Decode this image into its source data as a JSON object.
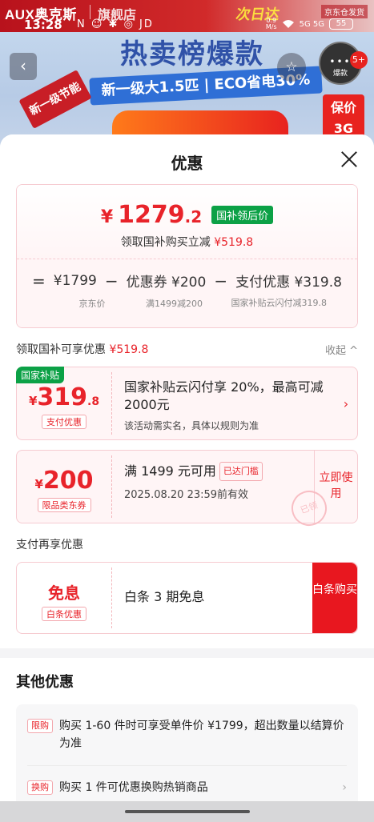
{
  "background": {
    "brand": "AUX奥克斯",
    "shop": "旗舰店",
    "promo": "次日达",
    "badge": "京东仓发货",
    "hero_title": "热卖榜爆款",
    "hero_sub": "新一级大1.5匹 | ECO省电30%",
    "hero_tag": "新一级节能",
    "hero_save": "保价 3G",
    "hot_label": "爆款",
    "hot_dots": "•••",
    "hot_count": "5+",
    "back_icon": "arrow-left-icon"
  },
  "status": {
    "time": "13:28",
    "icons": "N ☺ ✱ ◎ JD",
    "net_speed_value": "0.9",
    "net_speed_unit": "M/s",
    "wifi": "wifi-icon",
    "signal": "5G 5G",
    "battery": "55"
  },
  "sheet": {
    "title": "优惠",
    "close_icon": "close-icon"
  },
  "price": {
    "yen": "¥",
    "integer": "1279",
    "decimal": ".2",
    "badge": "国补领后价",
    "subtitle_prefix": "领取国补购买立减",
    "subtitle_amount": "¥519.8",
    "calc": {
      "equals": "=",
      "base": "¥1799",
      "minus": "−",
      "coupon": "优惠券 ¥200",
      "pay": "支付优惠 ¥319.8",
      "base_label": "京东价",
      "coupon_label": "满1499减200",
      "pay_label": "国家补贴云闪付减319.8"
    }
  },
  "subsidy": {
    "section_title": "领取国补可享优惠",
    "section_amount": "¥519.8",
    "collapse_label": "收起 ^",
    "corner_tag": "国家补贴",
    "amount_yen": "¥",
    "amount_int": "319",
    "amount_dec": ".8",
    "amount_tag": "支付优惠",
    "title": "国家补贴云闪付享 20%，最高可减 2000元",
    "desc": "该活动需实名，具体以规则为准",
    "arrow": "›"
  },
  "coupon200": {
    "amount_yen": "¥",
    "amount": "200",
    "tag": "限品类东券",
    "title": "满 1499 元可用",
    "reached": "已达门槛",
    "expire": "2025.08.20 23:59前有效",
    "action": "立即使用",
    "stamp": "已领"
  },
  "pay": {
    "section_title": "支付再享优惠",
    "amount": "免息",
    "tag": "白条优惠",
    "title": "白条 3 期免息",
    "action": "白条购买"
  },
  "other": {
    "title": "其他优惠",
    "items": [
      {
        "tag": "限购",
        "text": "购买 1-60 件时可享受单件价 ¥1799，超出数量以结算价为准"
      },
      {
        "tag": "换购",
        "text": "购买 1 件可优惠换购热销商品",
        "arrow": "›"
      }
    ]
  },
  "colors": {
    "accent": "#e8232a",
    "green": "#0ca146"
  }
}
